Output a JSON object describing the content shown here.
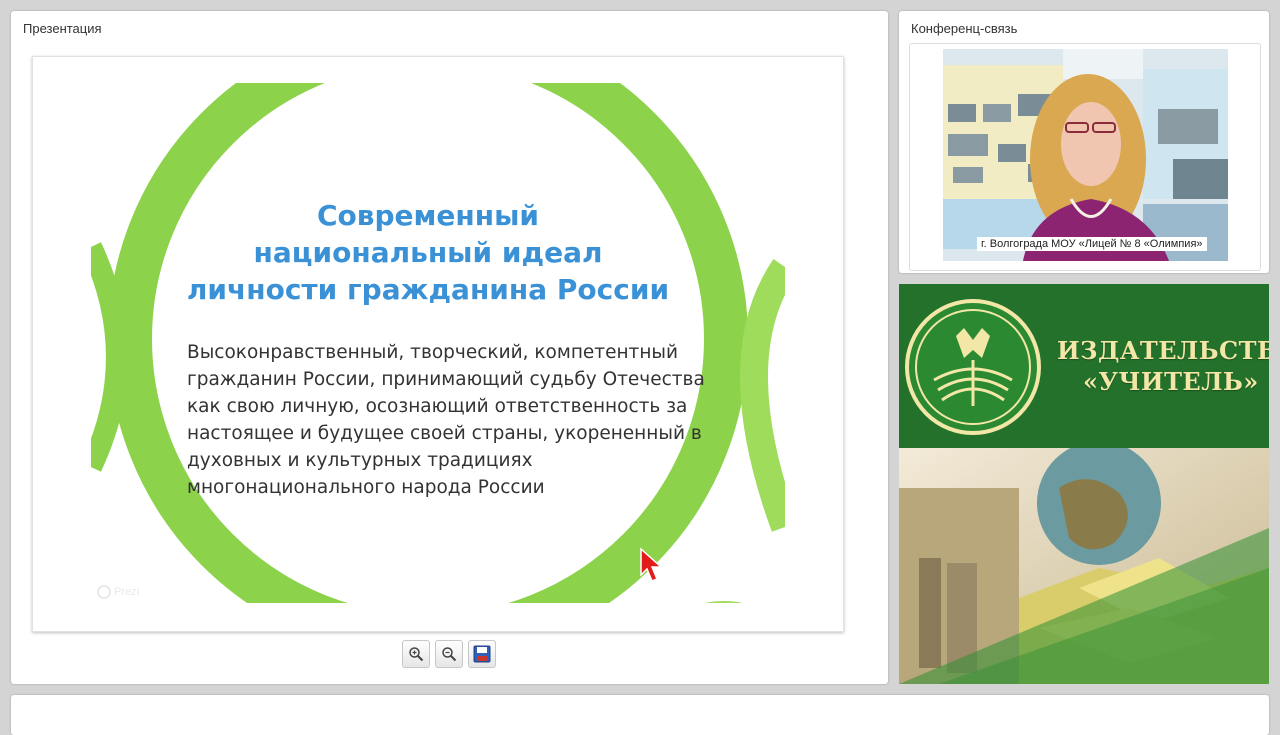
{
  "presentation": {
    "panel_title": "Презентация",
    "slide": {
      "title_lines": [
        "Современный",
        "национальный идеал",
        "личности гражданина России"
      ],
      "body_lines": [
        "Высоконравственный, творческий, компетентный",
        "гражданин России, принимающий судьбу Отечества",
        "как свою личную, осознающий ответственность за",
        "настоящее и будущее своей страны, укорененный в",
        "духовных и культурных традициях",
        "многонационального народа России"
      ],
      "watermark": "Prezi",
      "accent_color": "#8cd24a",
      "title_color": "#3a91d6"
    },
    "toolbar": {
      "zoom_in_icon": "zoom-in-icon",
      "zoom_out_icon": "zoom-out-icon",
      "save_icon": "save-icon"
    }
  },
  "conference": {
    "panel_title": "Конференц-связь",
    "video_caption": "г. Волгограда МОУ «Лицей № 8 «Олимпия»"
  },
  "advert": {
    "line1": "ИЗДАТЕЛЬСТВО",
    "line2": "«УЧИТЕЛЬ»",
    "brand_color": "#23712a",
    "text_color": "#f3e7a8"
  }
}
